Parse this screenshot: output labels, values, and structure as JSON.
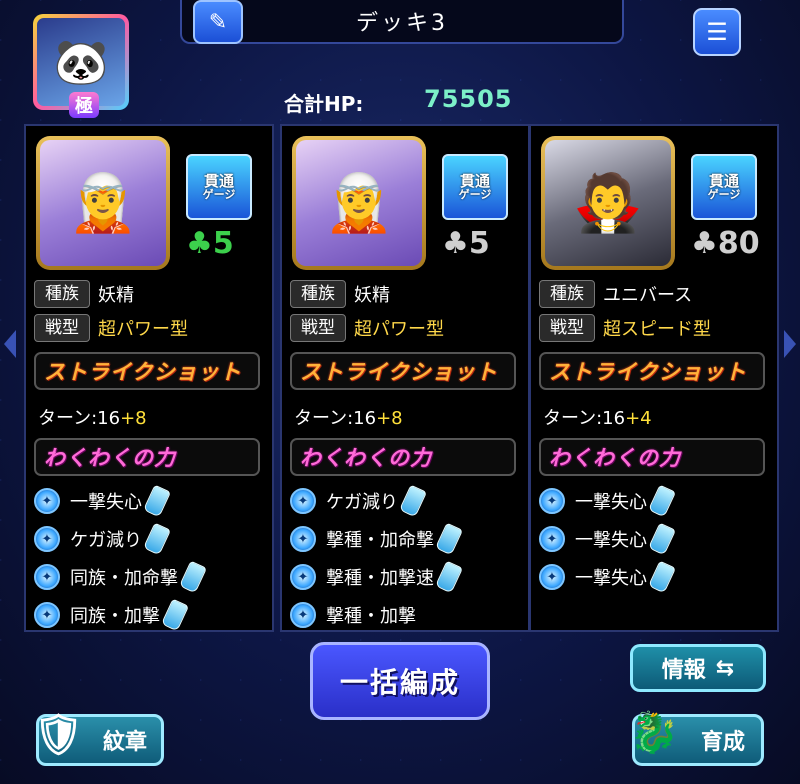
{
  "header": {
    "deck_title": "デッキ3",
    "edit_icon": "pencil-icon",
    "list_icon": "list-icon",
    "leader_rank": "極",
    "total_hp_label": "合計HP:",
    "total_hp_value": "75505"
  },
  "cards": [
    {
      "gauge_line1": "貫通",
      "gauge_line2": "ゲージ",
      "luck": "5",
      "tribe_label": "種族",
      "tribe": "妖精",
      "type_label": "戦型",
      "type": "超パワー型",
      "strike_shot": "ストライクショット",
      "turn_text": "ターン:16",
      "turn_plus": "+8",
      "waku_label": "わくわくの力",
      "skills": [
        "一撃失心",
        "ケガ減り",
        "同族・加命撃",
        "同族・加撃"
      ]
    },
    {
      "gauge_line1": "貫通",
      "gauge_line2": "ゲージ",
      "luck": "5",
      "tribe_label": "種族",
      "tribe": "妖精",
      "type_label": "戦型",
      "type": "超パワー型",
      "strike_shot": "ストライクショット",
      "turn_text": "ターン:16",
      "turn_plus": "+8",
      "waku_label": "わくわくの力",
      "skills": [
        "ケガ減り",
        "撃種・加命撃",
        "撃種・加撃速",
        "撃種・加撃"
      ]
    },
    {
      "gauge_line1": "貫通",
      "gauge_line2": "ゲージ",
      "luck": "80",
      "tribe_label": "種族",
      "tribe": "ユニバース",
      "type_label": "戦型",
      "type": "超スピード型",
      "strike_shot": "ストライクショット",
      "turn_text": "ターン:16",
      "turn_plus": "+4",
      "waku_label": "わくわくの力",
      "skills": [
        "一撃失心",
        "一撃失心",
        "一撃失心"
      ]
    }
  ],
  "buttons": {
    "bulk": "一括編成",
    "info": "情報",
    "info_icon": "swap-arrows-icon",
    "emblem": "紋章",
    "train": "育成"
  },
  "colors": {
    "luck_green": "#3cd04c",
    "luck_grey": "#cfcfcf",
    "hp_value": "#7cf0c8",
    "turn_plus": "#ffe03a",
    "type_text": "#ffd84a"
  }
}
